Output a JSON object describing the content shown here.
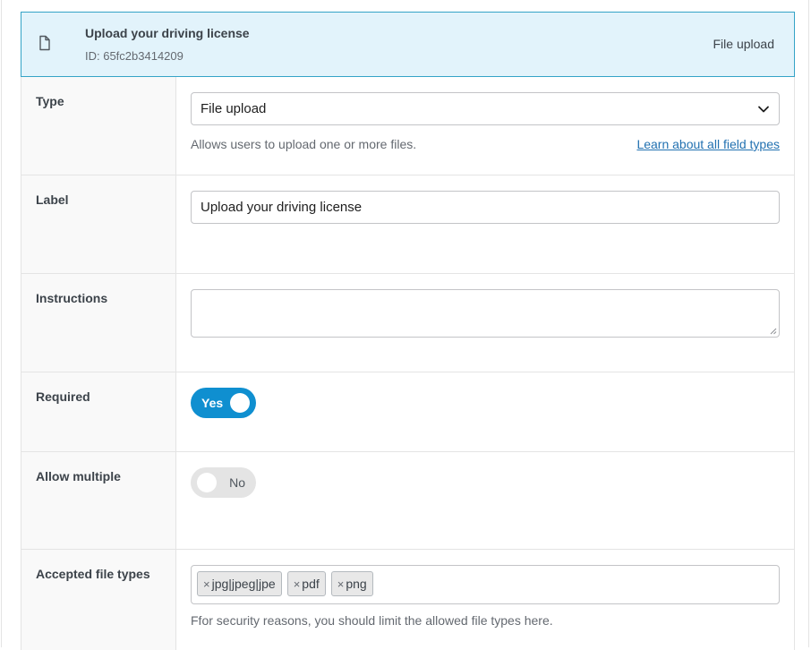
{
  "header": {
    "title": "Upload your driving license",
    "id_text": "ID: 65fc2b3414209",
    "type_text": "File upload",
    "icon": "file-icon"
  },
  "type_row": {
    "label": "Type",
    "selected": "File upload",
    "hint": "Allows users to upload one or more files.",
    "link": "Learn about all field types"
  },
  "label_row": {
    "label": "Label",
    "value": "Upload your driving license"
  },
  "instructions_row": {
    "label": "Instructions",
    "value": ""
  },
  "required_row": {
    "label": "Required",
    "toggle_text": "Yes",
    "state": "on"
  },
  "multiple_row": {
    "label": "Allow multiple",
    "toggle_text": "No",
    "state": "off"
  },
  "filetypes_row": {
    "label": "Accepted file types",
    "tags": [
      "jpg|jpeg|jpe",
      "pdf",
      "png"
    ],
    "remove_glyph": "×",
    "hint": "Ffor security reasons, you should limit the allowed file types here."
  },
  "colors": {
    "header_bg": "#e2f3fb",
    "header_border": "#34a3c7",
    "toggle_on": "#0f8fd0",
    "link": "#2271b1"
  }
}
